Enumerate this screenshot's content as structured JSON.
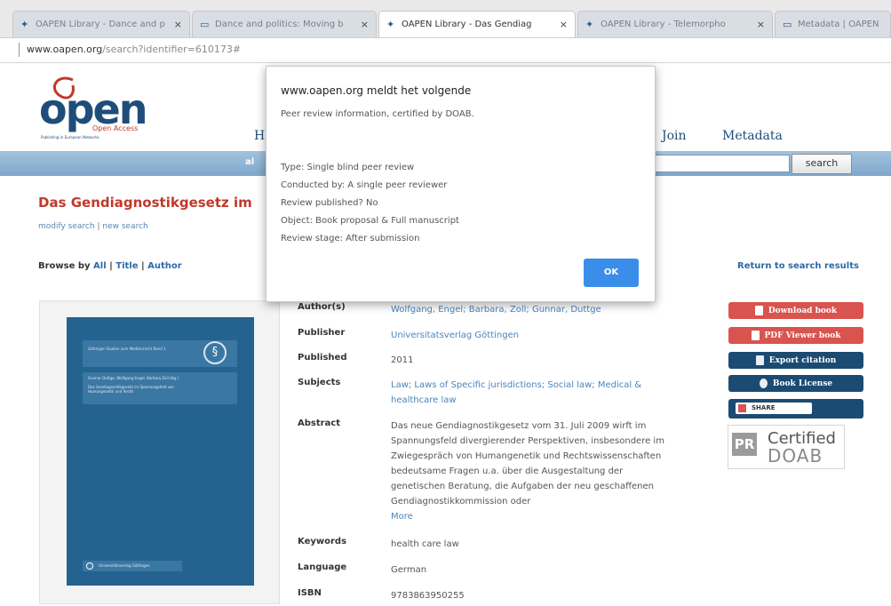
{
  "browser": {
    "tabs": [
      {
        "label": "OAPEN Library - Dance and p",
        "icon": "oapen-icon"
      },
      {
        "label": "Dance and politics: Moving b",
        "icon": "page-icon"
      },
      {
        "label": "OAPEN Library - Das Gendiag",
        "icon": "oapen-icon"
      },
      {
        "label": "OAPEN Library - Telemorpho",
        "icon": "oapen-icon"
      },
      {
        "label": "Metadata | OAPEN",
        "icon": "page-icon"
      }
    ],
    "close_glyph": "×",
    "url_host": "www.oapen.org",
    "url_rest": "/search?identifier=610173#"
  },
  "site": {
    "logo_text": "open",
    "logo_sub1": "Open Access",
    "logo_sub2": "Publishing in European Networks",
    "nav": {
      "home": "H",
      "join": "Join",
      "metadata": "Metadata"
    },
    "bar_text": "al",
    "search_label": "search"
  },
  "page": {
    "title": "Das Gendiagnostikgesetz im",
    "modify": "modify search",
    "pipe": "|",
    "new_search": "new search",
    "browse_prefix": "Browse by",
    "browse_all": "All",
    "browse_title": "Title",
    "browse_author": "Author",
    "return": "Return to search results"
  },
  "cover": {
    "series": "Göttinger Studien zum Medizinrecht Band 1",
    "authors": "Gunnar Duttge, Wolfgang Engel, Barbara Zoll (Hg.)",
    "book_title": "Das Gendiagnostikgesetz im Spannungsfeld von Humangenetik und Recht",
    "publisher": "Universitätsverlag Göttingen",
    "seal": "§"
  },
  "meta": {
    "authors_label": "Author(s)",
    "authors_value": "Wolfgang, Engel; Barbara, Zoll; Gunnar, Duttge",
    "publisher_label": "Publisher",
    "publisher_value": "Universitatsverlag Göttingen",
    "published_label": "Published",
    "published_value": "2011",
    "subjects_label": "Subjects",
    "subjects_value": "Law; Laws of Specific jurisdictions; Social law; Medical & healthcare law",
    "abstract_label": "Abstract",
    "abstract_value": "Das neue Gendiagnostikgesetz vom 31. Juli 2009 wirft im Spannungsfeld divergierender Perspektiven, insbesondere im Zwiegespräch von Humangenetik und Rechtswissenschaften bedeutsame Fragen u.a. über die Ausgestaltung der genetischen Beratung, die Aufgaben der neu geschaffenen Gendiagnostikkommission oder",
    "more": "More",
    "keywords_label": "Keywords",
    "keywords_value": "health care law",
    "language_label": "Language",
    "language_value": "German",
    "isbn_label": "ISBN",
    "isbn_value": "9783863950255"
  },
  "actions": {
    "download": "Download book",
    "pdf_viewer": "PDF Viewer book",
    "export": "Export citation",
    "license": "Book License",
    "share": "SHARE",
    "cert_pr": "PR",
    "cert_certified": "Certified",
    "cert_doab": "DOAB"
  },
  "dialog": {
    "title": "www.oapen.org meldt het volgende",
    "subtitle": "Peer review information, certified by DOAB.",
    "type": "Type: Single blind peer review",
    "conducted": "Conducted by:  A single peer reviewer",
    "published": "Review published?  No",
    "object": "Object:  Book proposal & Full manuscript",
    "stage": "Review stage:  After submission",
    "ok": "OK"
  },
  "colors": {
    "accent_red": "#c0392b",
    "nav_blue": "#1f4d7a",
    "ok_blue": "#3a8de8",
    "button_dark": "#1b4b72"
  }
}
